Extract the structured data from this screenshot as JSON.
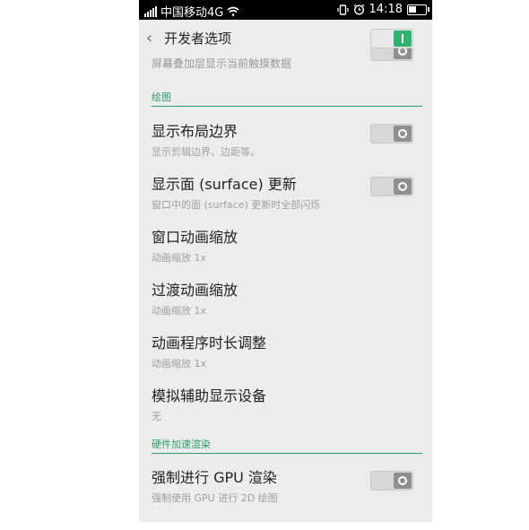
{
  "status_bar": {
    "carrier": "中国移动4G",
    "time": "14:18",
    "battery_level": 0.55,
    "icons": [
      "signal-icon",
      "wifi-icon",
      "vibrate-icon",
      "alarm-icon",
      "battery-icon"
    ]
  },
  "header": {
    "back_symbol": "‹",
    "title": "开发者选项",
    "master_toggle_on": true
  },
  "cut_off_item": {
    "subtitle": "屏幕叠加层显示当前触摸数据"
  },
  "sections": [
    {
      "label": "绘图",
      "items": [
        {
          "title": "显示布局边界",
          "subtitle": "显示剪辑边界、边距等。",
          "has_toggle": true,
          "toggle_on": false
        },
        {
          "title": "显示面 (surface) 更新",
          "subtitle": "窗口中的面 (surface) 更新时全部闪烁",
          "has_toggle": true,
          "toggle_on": false
        },
        {
          "title": "窗口动画缩放",
          "subtitle": "动画缩放 1x",
          "has_toggle": false
        },
        {
          "title": "过渡动画缩放",
          "subtitle": "动画缩放 1x",
          "has_toggle": false
        },
        {
          "title": "动画程序时长调整",
          "subtitle": "动画缩放 1x",
          "has_toggle": false
        },
        {
          "title": "模拟辅助显示设备",
          "subtitle": "无",
          "has_toggle": false
        }
      ]
    },
    {
      "label": "硬件加速渲染",
      "items": [
        {
          "title": "强制进行 GPU 渲染",
          "subtitle": "强制使用 GPU 进行 2D 绘图",
          "has_toggle": true,
          "toggle_on": false
        }
      ]
    }
  ],
  "colors": {
    "accent": "#2bb36f",
    "section": "#2a9d6a",
    "background": "#ececec"
  }
}
